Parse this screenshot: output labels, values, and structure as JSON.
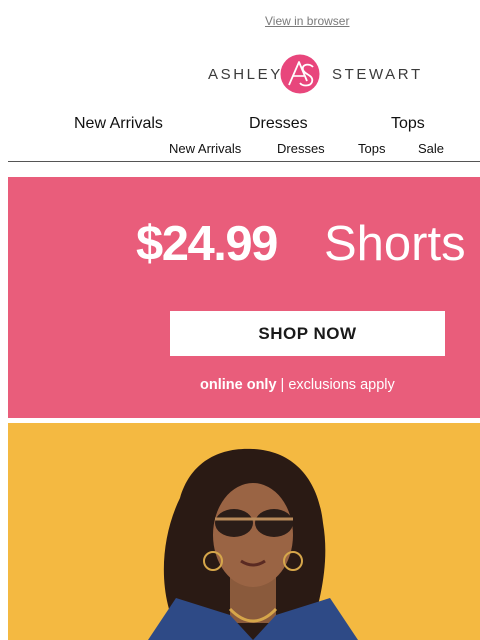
{
  "header": {
    "view_in_browser": "View in browser"
  },
  "logo": {
    "left_word": "ASHLEY",
    "right_word": "STEWART",
    "monogram": "AS",
    "brand_color": "#e8467c"
  },
  "nav_primary": [
    {
      "label": "New Arrivals"
    },
    {
      "label": "Dresses"
    },
    {
      "label": "Tops"
    }
  ],
  "nav_secondary": [
    {
      "label": "New Arrivals"
    },
    {
      "label": "Dresses"
    },
    {
      "label": "Tops"
    },
    {
      "label": "Sale"
    }
  ],
  "promo": {
    "price": "$24.99",
    "product": "Shorts",
    "button_label": "SHOP NOW",
    "note_bold": "online only",
    "note_rest": " | exclusions apply",
    "background_color": "#e95d7b"
  },
  "hero": {
    "background_color": "#f4b941"
  }
}
